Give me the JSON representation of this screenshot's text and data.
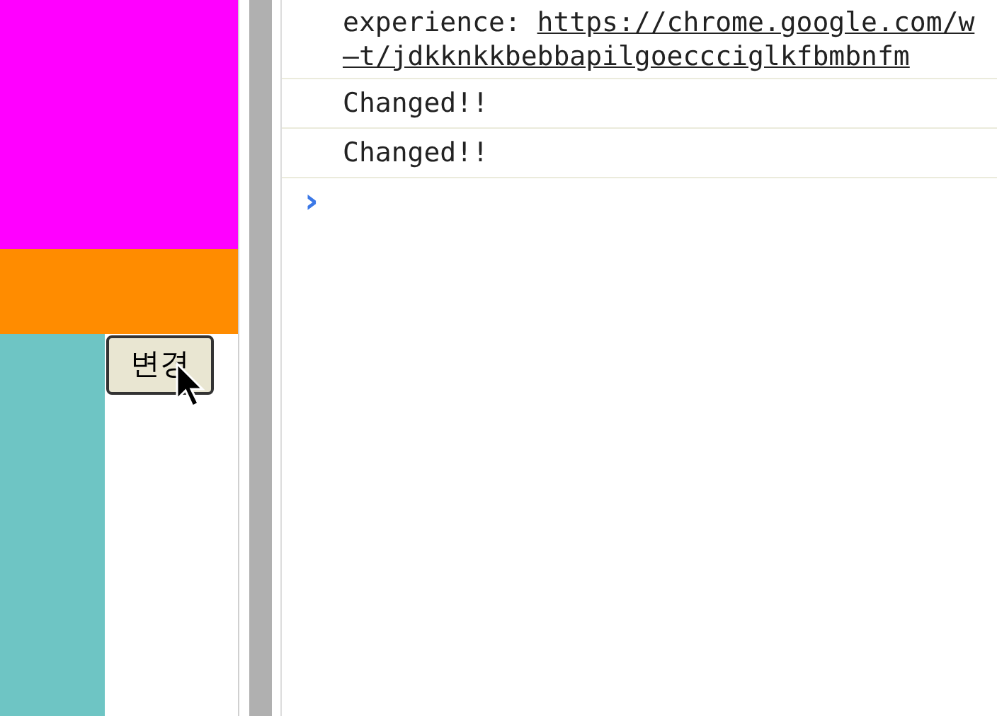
{
  "page": {
    "button": "변경"
  },
  "console": {
    "messages": [
      {
        "kind": "link",
        "text": "experience: ",
        "link_lines": [
          "https://chrome.google.com/w",
          "–t/jdkknkkbebbapilgoeccciglkfbmbnfm"
        ]
      },
      {
        "kind": "log",
        "text": "Changed!!"
      },
      {
        "kind": "log",
        "text": "Changed!!"
      }
    ],
    "prompt": "›"
  }
}
